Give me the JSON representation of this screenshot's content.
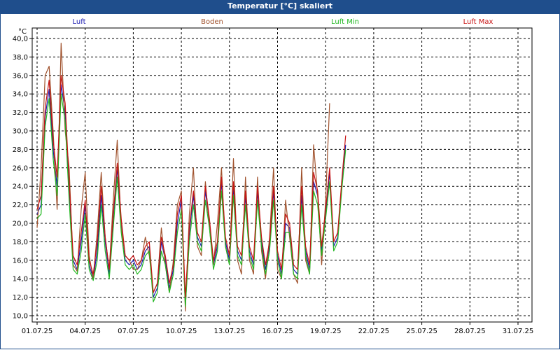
{
  "window_title": "Temperatur [°C] skaliert",
  "chart_data": {
    "type": "line",
    "title": "Temperatur [°C] skaliert",
    "ylabel": "°C",
    "xlabel": "",
    "ylim": [
      10.0,
      40.0
    ],
    "yticks": [
      "10,0",
      "12,0",
      "14,0",
      "16,0",
      "18,0",
      "20,0",
      "22,0",
      "24,0",
      "26,0",
      "28,0",
      "30,0",
      "32,0",
      "34,0",
      "36,0",
      "38,0",
      "40,0"
    ],
    "xlim": [
      0,
      31
    ],
    "xticks": [
      {
        "label": "01.07.25",
        "day": 0
      },
      {
        "label": "04.07.25",
        "day": 3
      },
      {
        "label": "07.07.25",
        "day": 6
      },
      {
        "label": "10.07.25",
        "day": 9
      },
      {
        "label": "13.07.25",
        "day": 12
      },
      {
        "label": "16.07.25",
        "day": 15
      },
      {
        "label": "19.07.25",
        "day": 18
      },
      {
        "label": "22.07.25",
        "day": 21
      },
      {
        "label": "25.07.25",
        "day": 24
      },
      {
        "label": "28.07.25",
        "day": 27
      },
      {
        "label": "31.07.25",
        "day": 30
      }
    ],
    "grid": true,
    "legend_position": "top",
    "series": [
      {
        "name": "Luft",
        "color": "#1a1ab0",
        "x": [
          0.0,
          0.25,
          0.5,
          0.75,
          1.0,
          1.25,
          1.5,
          1.75,
          2.0,
          2.25,
          2.5,
          2.75,
          3.0,
          3.25,
          3.5,
          3.75,
          4.0,
          4.25,
          4.5,
          4.75,
          5.0,
          5.25,
          5.5,
          5.75,
          6.0,
          6.25,
          6.5,
          6.75,
          7.0,
          7.25,
          7.5,
          7.75,
          8.0,
          8.25,
          8.5,
          8.75,
          9.0,
          9.25,
          9.5,
          9.75,
          10.0,
          10.25,
          10.5,
          10.75,
          11.0,
          11.25,
          11.5,
          11.75,
          12.0,
          12.25,
          12.5,
          12.75,
          13.0,
          13.25,
          13.5,
          13.75,
          14.0,
          14.25,
          14.5,
          14.75,
          15.0,
          15.25,
          15.5,
          15.75,
          16.0,
          16.25,
          16.5,
          16.75,
          17.0,
          17.25,
          17.5,
          17.75,
          18.0,
          18.25,
          18.5,
          18.75,
          19.0,
          19.25,
          19.5,
          19.75
        ],
        "y": [
          21.0,
          22.0,
          31.5,
          34.5,
          28.0,
          24.0,
          35.0,
          32.0,
          23.5,
          16.0,
          15.0,
          18.0,
          22.0,
          15.5,
          14.0,
          17.0,
          23.0,
          18.0,
          14.5,
          20.5,
          26.0,
          20.0,
          16.0,
          15.5,
          16.0,
          15.0,
          15.5,
          17.0,
          17.5,
          12.0,
          13.0,
          18.0,
          16.0,
          13.0,
          15.0,
          20.0,
          22.5,
          11.0,
          19.0,
          23.0,
          18.5,
          17.5,
          23.5,
          20.0,
          15.5,
          17.5,
          24.5,
          18.0,
          16.0,
          24.0,
          17.0,
          16.0,
          23.0,
          17.0,
          15.5,
          23.5,
          18.0,
          15.0,
          17.5,
          23.5,
          16.5,
          14.5,
          20.0,
          19.5,
          15.0,
          14.5,
          23.0,
          17.0,
          15.0,
          24.5,
          23.0,
          17.0,
          21.0,
          25.5,
          17.5,
          18.5,
          24.0,
          28.5,
          null,
          null
        ]
      },
      {
        "name": "Boden",
        "color": "#a0522d",
        "x": [
          0.0,
          0.25,
          0.5,
          0.75,
          1.0,
          1.25,
          1.5,
          1.75,
          2.0,
          2.25,
          2.5,
          2.75,
          3.0,
          3.25,
          3.5,
          3.75,
          4.0,
          4.25,
          4.5,
          4.75,
          5.0,
          5.25,
          5.5,
          5.75,
          6.0,
          6.25,
          6.5,
          6.75,
          7.0,
          7.25,
          7.5,
          7.75,
          8.0,
          8.25,
          8.5,
          8.75,
          9.0,
          9.25,
          9.5,
          9.75,
          10.0,
          10.25,
          10.5,
          10.75,
          11.0,
          11.25,
          11.5,
          11.75,
          12.0,
          12.25,
          12.5,
          12.75,
          13.0,
          13.25,
          13.5,
          13.75,
          14.0,
          14.25,
          14.5,
          14.75,
          15.0,
          15.25,
          15.5,
          15.75,
          16.0,
          16.25,
          16.5,
          16.75,
          17.0,
          17.25,
          17.5,
          17.75,
          18.0,
          18.25,
          18.5,
          18.75,
          19.0,
          19.25,
          19.5,
          19.75
        ],
        "y": [
          19.5,
          26.0,
          36.0,
          37.0,
          30.0,
          21.5,
          39.5,
          30.0,
          26.0,
          15.5,
          14.8,
          21.5,
          25.5,
          16.5,
          14.0,
          19.0,
          25.5,
          18.5,
          15.0,
          22.5,
          29.0,
          19.5,
          16.5,
          16.0,
          15.0,
          15.0,
          16.0,
          18.5,
          16.5,
          12.5,
          13.5,
          19.5,
          15.5,
          12.5,
          16.0,
          22.0,
          23.5,
          10.5,
          21.0,
          26.0,
          17.5,
          16.5,
          24.5,
          19.5,
          15.5,
          20.0,
          26.0,
          17.5,
          15.5,
          27.0,
          16.0,
          14.5,
          25.0,
          16.0,
          14.5,
          25.0,
          17.0,
          14.0,
          18.5,
          26.0,
          15.0,
          14.0,
          22.5,
          18.5,
          14.5,
          13.5,
          26.0,
          16.0,
          14.5,
          28.5,
          23.0,
          15.5,
          22.5,
          33.0,
          null,
          null,
          null,
          null,
          null,
          null
        ]
      },
      {
        "name": "Luft Min",
        "color": "#22b822",
        "x": [
          0.0,
          0.25,
          0.5,
          0.75,
          1.0,
          1.25,
          1.5,
          1.75,
          2.0,
          2.25,
          2.5,
          2.75,
          3.0,
          3.25,
          3.5,
          3.75,
          4.0,
          4.25,
          4.5,
          4.75,
          5.0,
          5.25,
          5.5,
          5.75,
          6.0,
          6.25,
          6.5,
          6.75,
          7.0,
          7.25,
          7.5,
          7.75,
          8.0,
          8.25,
          8.5,
          8.75,
          9.0,
          9.25,
          9.5,
          9.75,
          10.0,
          10.25,
          10.5,
          10.75,
          11.0,
          11.25,
          11.5,
          11.75,
          12.0,
          12.25,
          12.5,
          12.75,
          13.0,
          13.25,
          13.5,
          13.75,
          14.0,
          14.25,
          14.5,
          14.75,
          15.0,
          15.25,
          15.5,
          15.75,
          16.0,
          16.25,
          16.5,
          16.75,
          17.0,
          17.25,
          17.5,
          17.75,
          18.0,
          18.25,
          18.5,
          18.75,
          19.0,
          19.25,
          19.5,
          19.75
        ],
        "y": [
          20.5,
          21.0,
          30.5,
          33.5,
          27.0,
          23.0,
          34.0,
          31.0,
          22.5,
          15.0,
          14.5,
          17.0,
          21.0,
          15.0,
          13.8,
          16.0,
          22.0,
          17.0,
          14.0,
          19.5,
          25.0,
          19.0,
          15.5,
          15.0,
          15.5,
          14.5,
          15.0,
          16.5,
          17.0,
          11.5,
          12.5,
          17.0,
          15.5,
          12.5,
          14.5,
          19.0,
          21.5,
          11.0,
          18.0,
          22.0,
          18.0,
          17.0,
          22.5,
          19.5,
          15.0,
          17.0,
          23.5,
          17.5,
          15.5,
          23.0,
          16.5,
          15.5,
          22.0,
          16.5,
          15.0,
          22.5,
          17.5,
          14.5,
          17.0,
          22.5,
          16.0,
          14.0,
          19.0,
          19.0,
          14.5,
          14.0,
          22.0,
          16.5,
          14.5,
          23.5,
          22.0,
          16.5,
          20.5,
          24.5,
          17.0,
          18.0,
          23.5,
          28.0,
          null,
          null
        ]
      },
      {
        "name": "Luft Max",
        "color": "#c81414",
        "x": [
          0.0,
          0.25,
          0.5,
          0.75,
          1.0,
          1.25,
          1.5,
          1.75,
          2.0,
          2.25,
          2.5,
          2.75,
          3.0,
          3.25,
          3.5,
          3.75,
          4.0,
          4.25,
          4.5,
          4.75,
          5.0,
          5.25,
          5.5,
          5.75,
          6.0,
          6.25,
          6.5,
          6.75,
          7.0,
          7.25,
          7.5,
          7.75,
          8.0,
          8.25,
          8.5,
          8.75,
          9.0,
          9.25,
          9.5,
          9.75,
          10.0,
          10.25,
          10.5,
          10.75,
          11.0,
          11.25,
          11.5,
          11.75,
          12.0,
          12.25,
          12.5,
          12.75,
          13.0,
          13.25,
          13.5,
          13.75,
          14.0,
          14.25,
          14.5,
          14.75,
          15.0,
          15.25,
          15.5,
          15.75,
          16.0,
          16.25,
          16.5,
          16.75,
          17.0,
          17.25,
          17.5,
          17.75,
          18.0,
          18.25,
          18.5,
          18.75,
          19.0,
          19.25,
          19.5,
          19.75
        ],
        "y": [
          21.5,
          23.0,
          32.5,
          35.5,
          29.0,
          25.0,
          36.0,
          33.0,
          24.5,
          16.5,
          15.5,
          19.0,
          22.5,
          16.0,
          14.5,
          18.0,
          24.0,
          18.5,
          15.0,
          21.0,
          26.5,
          20.5,
          16.5,
          16.0,
          16.5,
          15.5,
          16.0,
          17.5,
          18.0,
          12.5,
          13.5,
          18.5,
          16.5,
          13.5,
          15.5,
          21.0,
          23.0,
          12.0,
          19.5,
          23.5,
          19.0,
          18.0,
          24.0,
          20.5,
          16.0,
          18.0,
          25.0,
          18.5,
          16.5,
          24.5,
          17.5,
          16.5,
          23.5,
          17.5,
          16.0,
          24.0,
          18.5,
          15.5,
          18.0,
          24.0,
          17.0,
          15.0,
          21.0,
          20.0,
          15.5,
          15.0,
          24.0,
          17.5,
          15.5,
          25.5,
          23.5,
          17.5,
          21.5,
          26.0,
          18.0,
          19.0,
          24.5,
          29.5,
          null,
          null
        ]
      }
    ]
  }
}
